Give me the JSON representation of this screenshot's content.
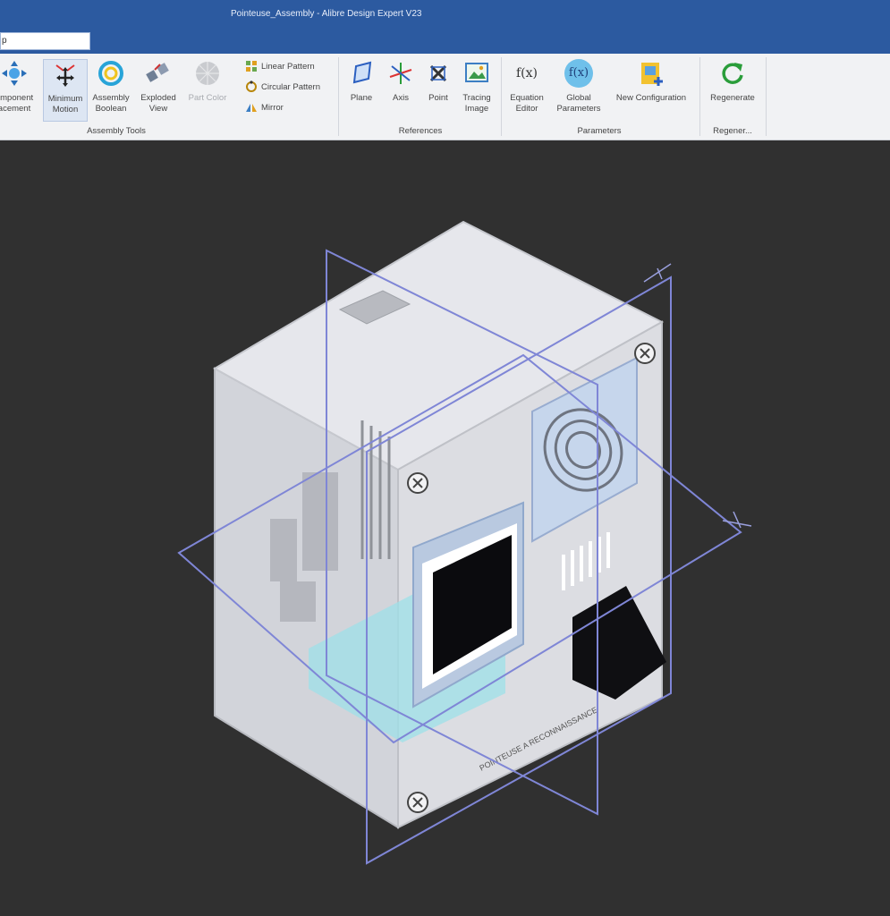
{
  "window": {
    "title": "Pointeuse_Assembly - Alibre Design Expert V23"
  },
  "search": {
    "value": "p"
  },
  "ribbon": {
    "assembly_tools": {
      "label": "Assembly Tools",
      "component_placement": {
        "line1": "omponent",
        "line2": "acement",
        "icon": "move-arrows-icon"
      },
      "minimum_motion": {
        "line1": "Minimum",
        "line2": "Motion",
        "icon": "minimum-motion-icon"
      },
      "assembly_boolean": {
        "line1": "Assembly",
        "line2": "Boolean",
        "icon": "boolean-rings-icon"
      },
      "exploded_view": {
        "line1": "Exploded",
        "line2": "View",
        "icon": "exploded-view-icon"
      },
      "part_color": {
        "line1": "Part Color",
        "icon": "color-ball-icon"
      },
      "linear_pattern": {
        "label": "Linear Pattern",
        "icon": "linear-pattern-icon"
      },
      "circular_pattern": {
        "label": "Circular Pattern",
        "icon": "circular-pattern-icon"
      },
      "mirror": {
        "label": "Mirror",
        "icon": "mirror-icon"
      }
    },
    "references": {
      "label": "References",
      "plane": {
        "label": "Plane",
        "icon": "plane-icon"
      },
      "axis": {
        "label": "Axis",
        "icon": "axis-icon"
      },
      "point": {
        "label": "Point",
        "icon": "point-icon"
      },
      "tracing_image": {
        "line1": "Tracing",
        "line2": "Image",
        "icon": "tracing-image-icon"
      }
    },
    "parameters": {
      "label": "Parameters",
      "equation_editor": {
        "line1": "Equation",
        "line2": "Editor",
        "icon_text": "f(x)"
      },
      "global_parameters": {
        "line1": "Global",
        "line2": "Parameters",
        "icon_text": "f(x)"
      },
      "new_configuration": {
        "label": "New Configuration",
        "icon": "new-configuration-icon"
      }
    },
    "regenerate": {
      "label": "Regener...",
      "button": {
        "label": "Regenerate",
        "icon": "regenerate-icon"
      }
    }
  },
  "viewport": {
    "background": "#303030",
    "model": {
      "name": "Pointeuse_Assembly",
      "engraving": "POINTEUSE A RECONNAISSANCE"
    }
  },
  "colors": {
    "titlebar": "#2c5aa0",
    "ribbon_bg": "#f1f2f4",
    "plane_outline": "#7f86d6",
    "enclosure": "#d6d8de",
    "display_accent": "#8fd3e0"
  }
}
